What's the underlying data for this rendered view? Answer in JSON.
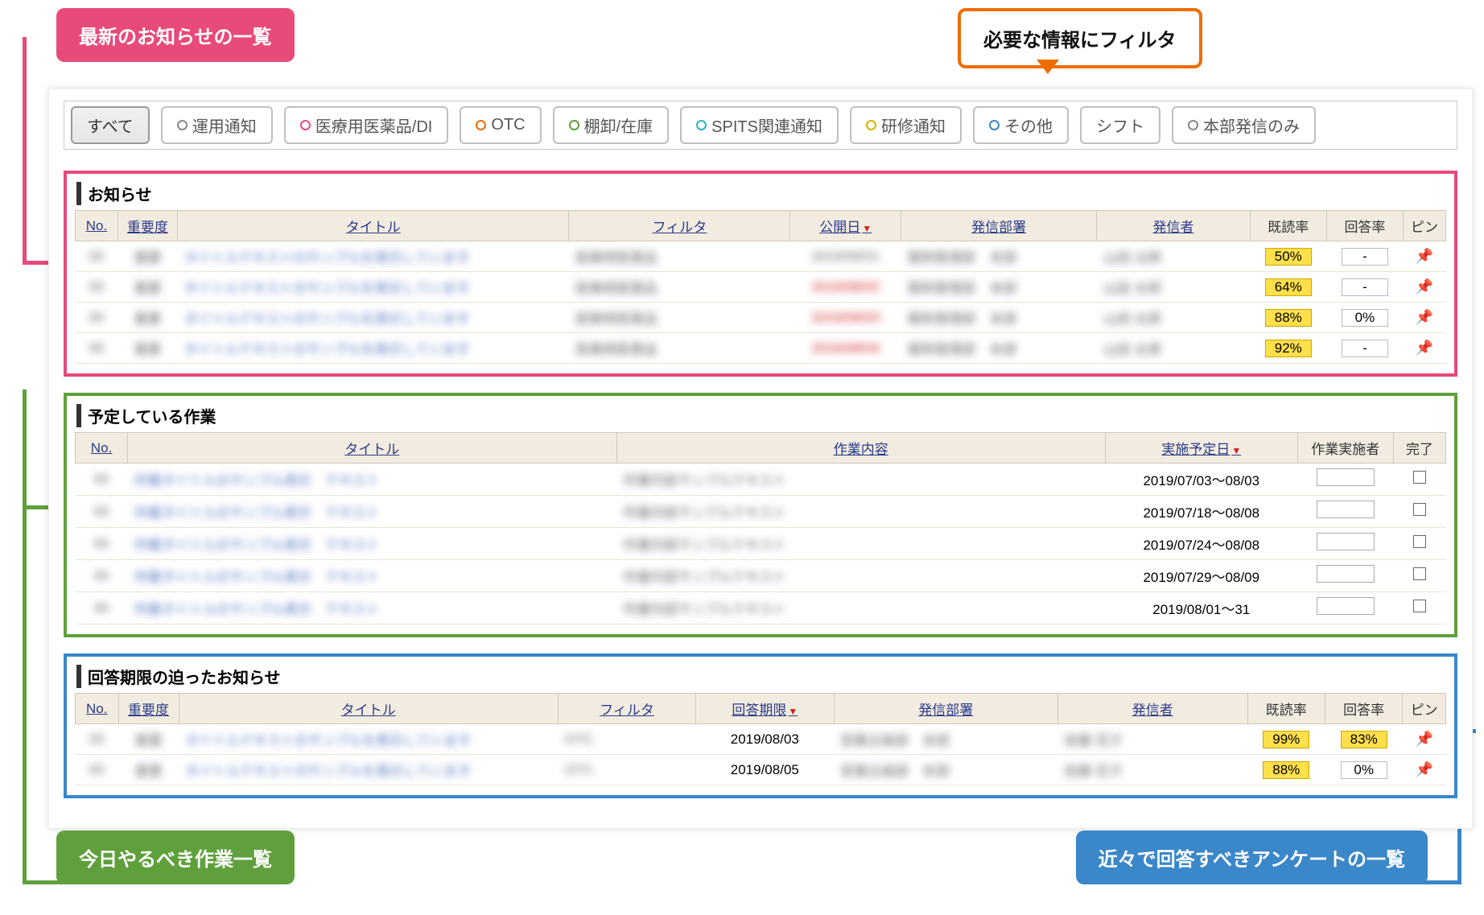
{
  "callouts": {
    "pink": "最新のお知らせの一覧",
    "orange": "必要な情報にフィルタ",
    "green": "今日やるべき作業一覧",
    "blue": "近々で回答すべきアンケートの一覧"
  },
  "filters": {
    "all": "すべて",
    "f1": "運用通知",
    "f2": "医療用医薬品/DI",
    "f3": "OTC",
    "f4": "棚卸/在庫",
    "f5": "SPITS関連通知",
    "f6": "研修通知",
    "f7": "その他",
    "f8": "シフト",
    "f9": "本部発信のみ"
  },
  "notice": {
    "title": "お知らせ",
    "headers": {
      "no": "No.",
      "importance": "重要度",
      "title": "タイトル",
      "filter": "フィルタ",
      "pubdate": "公開日",
      "dept": "発信部署",
      "sender": "発信者",
      "readrate": "既読率",
      "ansrate": "回答率",
      "pin": "ピン"
    },
    "rows": [
      {
        "read": "50%",
        "ans": "-",
        "pin": false
      },
      {
        "read": "64%",
        "ans": "-",
        "pin": false
      },
      {
        "read": "88%",
        "ans": "0%",
        "pin": true
      },
      {
        "read": "92%",
        "ans": "-",
        "pin": false
      }
    ]
  },
  "tasks": {
    "title": "予定している作業",
    "headers": {
      "no": "No.",
      "title": "タイトル",
      "content": "作業内容",
      "planned": "実施予定日",
      "worker": "作業実施者",
      "done": "完了"
    },
    "rows": [
      {
        "planned": "2019/07/03～08/03"
      },
      {
        "planned": "2019/07/18～08/08"
      },
      {
        "planned": "2019/07/24～08/08"
      },
      {
        "planned": "2019/07/29～08/09"
      },
      {
        "planned": "2019/08/01～31"
      }
    ]
  },
  "deadline": {
    "title": "回答期限の迫ったお知らせ",
    "headers": {
      "no": "No.",
      "importance": "重要度",
      "title": "タイトル",
      "filter": "フィルタ",
      "due": "回答期限",
      "dept": "発信部署",
      "sender": "発信者",
      "readrate": "既読率",
      "ansrate": "回答率",
      "pin": "ピン"
    },
    "rows": [
      {
        "due": "2019/08/03",
        "read": "99%",
        "ans": "83%",
        "pin": false
      },
      {
        "due": "2019/08/05",
        "read": "88%",
        "ans": "0%",
        "pin": true
      }
    ]
  }
}
